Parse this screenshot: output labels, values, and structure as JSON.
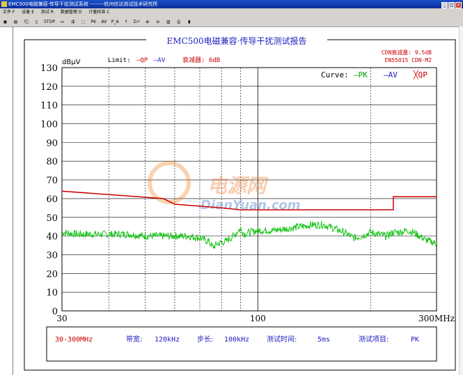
{
  "window": {
    "title": "EMC500电磁兼容·传导干扰测试系统   --------杭州伏达测试技术研究所",
    "buttons": [
      "_",
      "□",
      "×"
    ]
  },
  "menu": [
    "文件 F",
    "设备 E",
    "测试 R",
    "数据管理 D",
    "计量校准 C"
  ],
  "toolbar": [
    "▣",
    "▤",
    "?⃞",
    "▯",
    "STOP",
    "↦",
    "⇶",
    "⬚",
    "PK",
    "AV",
    "P_A",
    "↑",
    "D↗",
    "⊕",
    "⊖",
    "▥",
    "⎙",
    "▮"
  ],
  "report": {
    "title": "EMC500电磁兼容·传导干扰测试报告",
    "limit_label": "Limit:",
    "limit_qp": "—QP",
    "limit_av": "—AV",
    "attenuator": "衰减器: 6dB",
    "cdn_attenuation": "CDN衰减量: 9.5dB",
    "standard": "EN55015 CDN-M2",
    "curve_label": "Curve:",
    "curve_pk": "—PK",
    "curve_av": "—AV",
    "curve_qp": "╳QP",
    "watermark_cn": "电源网",
    "watermark_en": "DianYuan.com"
  },
  "settings": {
    "range": "30-300MHz",
    "bandwidth_label": "带宽:",
    "bandwidth": "120kHz",
    "step_label": "步长:",
    "step": "100kHz",
    "time_label": "测试时间:",
    "time": "5ms",
    "item_label": "测试项目:",
    "item": "PK"
  },
  "colors": {
    "pk": "#00c000",
    "limit": "#cc0000",
    "label_red": "#cc0000",
    "label_blue": "#2020c0"
  },
  "chart_data": {
    "type": "line",
    "ylabel": "dBμV",
    "xlabel": "MHz",
    "x_scale": "log",
    "xlim": [
      30,
      300
    ],
    "ylim": [
      0,
      130
    ],
    "yticks": [
      0,
      10,
      20,
      30,
      40,
      50,
      60,
      70,
      80,
      90,
      100,
      110,
      120,
      130
    ],
    "xtick_labels": [
      "30",
      "100",
      "300MHz"
    ],
    "xticks": [
      30,
      100,
      300
    ],
    "minor_x_lines": [
      40,
      50,
      60,
      70,
      80,
      90,
      200
    ],
    "grid": true,
    "series": [
      {
        "name": "QP Limit",
        "color": "#cc0000",
        "points": [
          [
            30,
            64
          ],
          [
            56,
            60
          ],
          [
            60,
            57
          ],
          [
            70,
            56
          ],
          [
            80,
            55
          ],
          [
            90,
            54
          ],
          [
            100,
            54
          ],
          [
            230,
            54
          ],
          [
            230,
            61
          ],
          [
            300,
            61
          ]
        ]
      },
      {
        "name": "PK",
        "color": "#00c000",
        "points": [
          [
            30,
            42
          ],
          [
            33,
            41
          ],
          [
            36,
            41
          ],
          [
            40,
            41
          ],
          [
            45,
            41
          ],
          [
            50,
            40
          ],
          [
            55,
            40
          ],
          [
            60,
            40
          ],
          [
            65,
            40
          ],
          [
            70,
            39
          ],
          [
            74,
            37
          ],
          [
            76,
            34
          ],
          [
            78,
            36
          ],
          [
            82,
            37
          ],
          [
            86,
            40
          ],
          [
            90,
            44
          ],
          [
            92,
            41
          ],
          [
            95,
            42
          ],
          [
            100,
            43
          ],
          [
            110,
            43
          ],
          [
            120,
            44
          ],
          [
            130,
            45
          ],
          [
            140,
            46
          ],
          [
            150,
            46
          ],
          [
            160,
            44
          ],
          [
            170,
            42
          ],
          [
            180,
            39
          ],
          [
            190,
            40
          ],
          [
            200,
            42
          ],
          [
            210,
            41
          ],
          [
            220,
            40
          ],
          [
            230,
            42
          ],
          [
            240,
            42
          ],
          [
            250,
            43
          ],
          [
            260,
            42
          ],
          [
            270,
            40
          ],
          [
            280,
            38
          ],
          [
            290,
            37
          ],
          [
            300,
            36
          ]
        ]
      }
    ]
  }
}
